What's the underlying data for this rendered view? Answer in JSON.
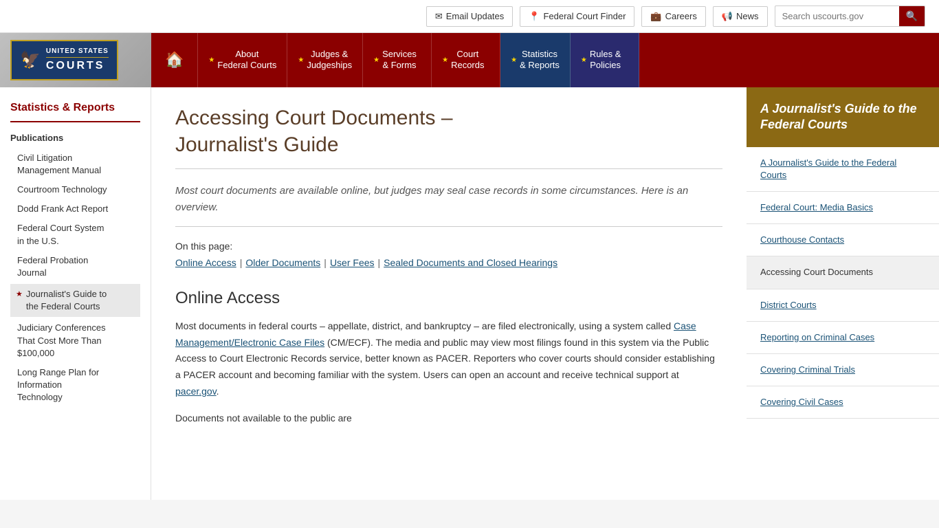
{
  "topbar": {
    "email_updates": "Email Updates",
    "federal_court_finder": "Federal Court Finder",
    "careers": "Careers",
    "news": "News",
    "search_placeholder": "Search uscourts.gov"
  },
  "logo": {
    "line1": "UNITED STATES",
    "line2": "COURTS"
  },
  "nav": {
    "home_icon": "🏠",
    "items": [
      {
        "id": "about",
        "label": "About\nFederal Courts",
        "active": false
      },
      {
        "id": "judges",
        "label": "Judges &\nJudgeships",
        "active": false
      },
      {
        "id": "services",
        "label": "Services\n& Forms",
        "active": false
      },
      {
        "id": "court-records",
        "label": "Court\nRecords",
        "active": false
      },
      {
        "id": "statistics",
        "label": "Statistics\n& Reports",
        "active": true
      },
      {
        "id": "rules",
        "label": "Rules &\nPolicies",
        "active": false
      }
    ]
  },
  "left_sidebar": {
    "title": "Statistics &\nReports",
    "section": "Publications",
    "links": [
      {
        "id": "civil-litigation",
        "label": "Civil Litigation\nManagement Manual",
        "active": false
      },
      {
        "id": "courtroom-tech",
        "label": "Courtroom Technology",
        "active": false
      },
      {
        "id": "dodd-frank",
        "label": "Dodd Frank Act Report",
        "active": false
      },
      {
        "id": "federal-court-system",
        "label": "Federal Court System\nin the U.S.",
        "active": false
      },
      {
        "id": "federal-probation",
        "label": "Federal Probation\nJournal",
        "active": false
      },
      {
        "id": "journalists-guide",
        "label": "Journalist's Guide to\nthe Federal Courts",
        "active": true
      },
      {
        "id": "judiciary-conferences",
        "label": "Judiciary Conferences\nThat Cost More Than\n$100,000",
        "active": false
      },
      {
        "id": "long-range-plan",
        "label": "Long Range Plan for\nInformation\nTechnology",
        "active": false
      }
    ]
  },
  "main": {
    "page_title": "Accessing Court Documents –\nJournalist's Guide",
    "intro_text": "Most court documents are available online, but judges may seal case records in some circumstances. Here is an overview.",
    "on_page_label": "On this page:",
    "page_links": [
      {
        "label": "Online Access",
        "id": "online-access"
      },
      {
        "label": "Older Documents",
        "id": "older-docs"
      },
      {
        "label": "User Fees",
        "id": "user-fees"
      },
      {
        "label": "Sealed Documents and Closed Hearings",
        "id": "sealed-docs"
      }
    ],
    "section_title": "Online Access",
    "paragraph1": "Most documents in federal courts – appellate, district, and bankruptcy – are filed electronically, using a system called ",
    "cmecf_link": "Case Management/Electronic Case Files",
    "paragraph1b": " (CM/ECF). The media and public may view most filings found in this system via the Public Access to Court Electronic Records service, better known as PACER. Reporters who cover courts should consider establishing a PACER account and becoming familiar with the system. Users can open an account and receive technical support at ",
    "pacer_link": "pacer.gov",
    "paragraph2": "Documents not available to the public are"
  },
  "right_sidebar": {
    "title": "A Journalist's Guide to the Federal Courts",
    "links": [
      {
        "id": "journalists-guide-link",
        "label": "A Journalist's Guide to the Federal Courts",
        "active": false
      },
      {
        "id": "media-basics",
        "label": "Federal Court: Media Basics",
        "active": false
      },
      {
        "id": "courthouse-contacts",
        "label": "Courthouse Contacts",
        "active": false
      },
      {
        "id": "accessing-docs",
        "label": "Accessing Court Documents",
        "active": true
      },
      {
        "id": "district-courts",
        "label": "District Courts",
        "active": false
      },
      {
        "id": "reporting-criminal",
        "label": "Reporting on Criminal Cases",
        "active": false
      },
      {
        "id": "covering-criminal-trials",
        "label": "Covering Criminal Trials",
        "active": false
      },
      {
        "id": "covering-civil",
        "label": "Covering Civil Cases",
        "active": false
      }
    ]
  }
}
